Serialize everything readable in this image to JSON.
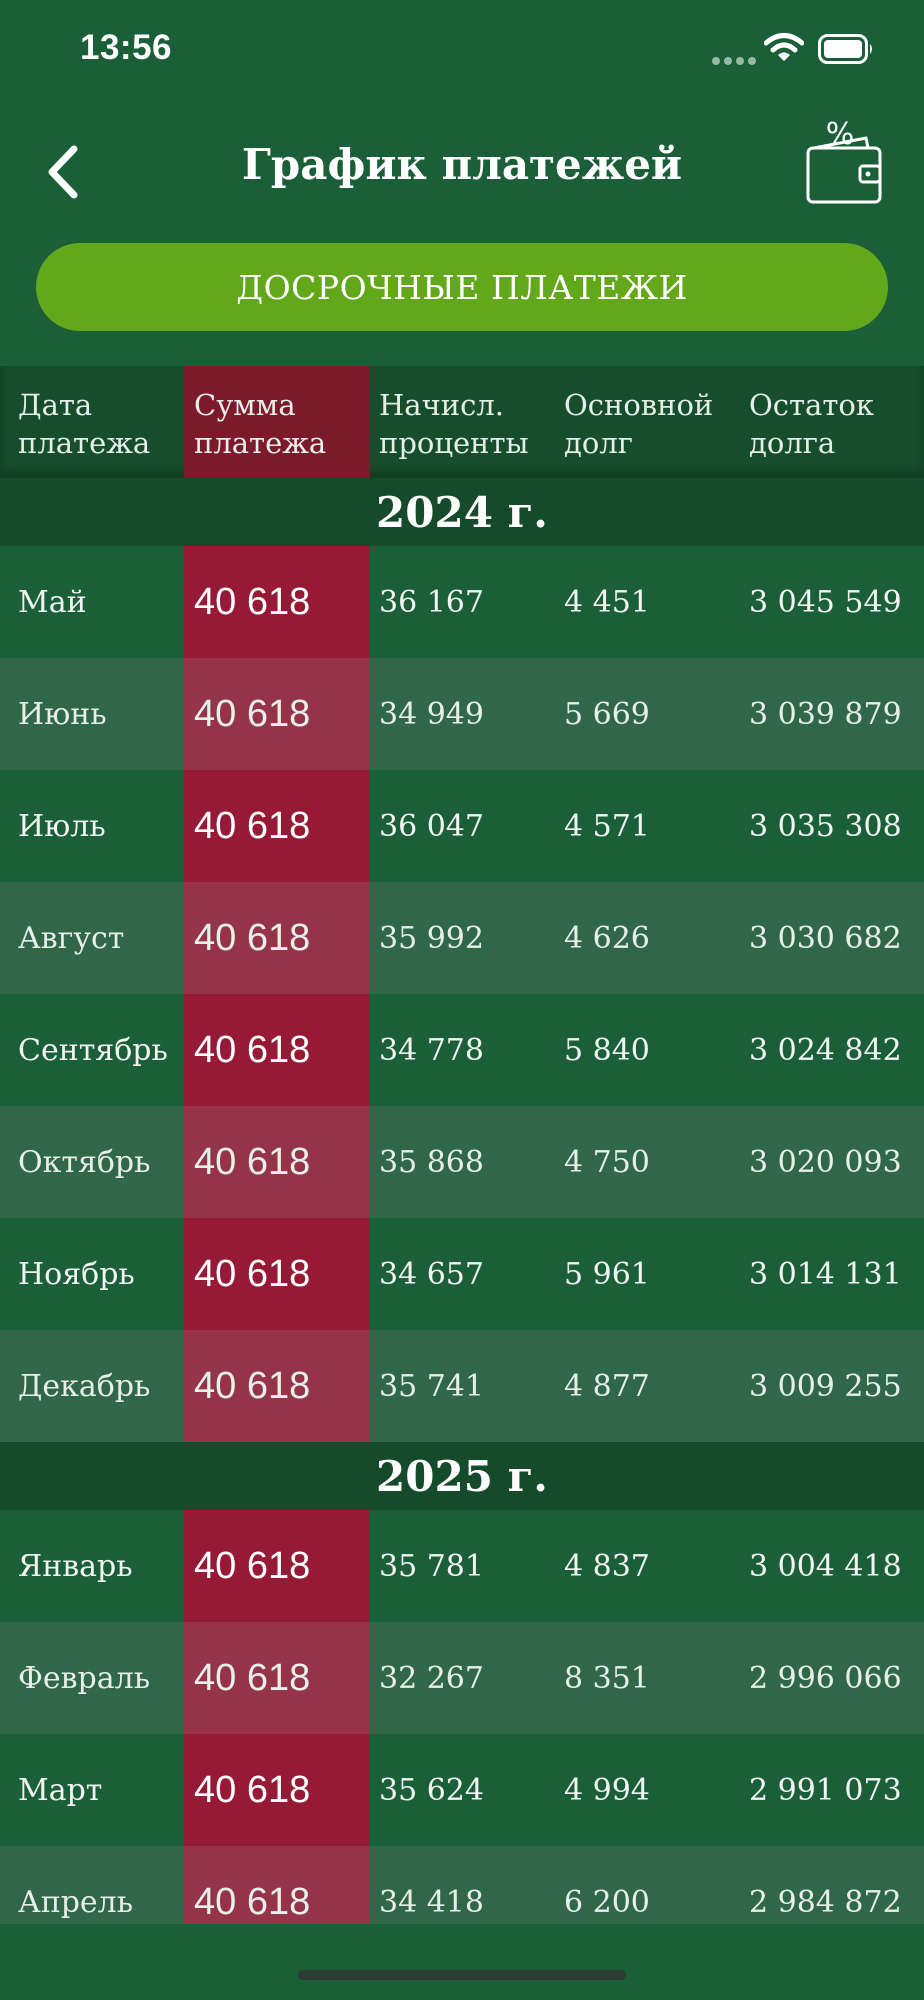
{
  "status_bar": {
    "time": "13:56"
  },
  "header": {
    "title": "График платежей",
    "back_icon": "chevron-left-icon",
    "wallet_icon": "wallet-percent-icon"
  },
  "early_payments_button": {
    "label": "ДОСРОЧНЫЕ ПЛАТЕЖИ",
    "color": "#63a81a"
  },
  "colors": {
    "background": "#1b5f38",
    "highlight_column": "#961a35"
  },
  "table": {
    "columns": [
      [
        "Дата",
        "платежа"
      ],
      [
        "Сумма",
        "платежа"
      ],
      [
        "Начисл.",
        "проценты"
      ],
      [
        "Основной",
        "долг"
      ],
      [
        "Остаток",
        "долга"
      ]
    ],
    "groups": [
      {
        "year": "2024 г.",
        "rows": [
          [
            "Май",
            "40 618",
            "36 167",
            "4 451",
            "3 045 549"
          ],
          [
            "Июнь",
            "40 618",
            "34 949",
            "5 669",
            "3 039 879"
          ],
          [
            "Июль",
            "40 618",
            "36 047",
            "4 571",
            "3 035 308"
          ],
          [
            "Август",
            "40 618",
            "35 992",
            "4 626",
            "3 030 682"
          ],
          [
            "Сентябрь",
            "40 618",
            "34 778",
            "5 840",
            "3 024 842"
          ],
          [
            "Октябрь",
            "40 618",
            "35 868",
            "4 750",
            "3 020 093"
          ],
          [
            "Ноябрь",
            "40 618",
            "34 657",
            "5 961",
            "3 014 131"
          ],
          [
            "Декабрь",
            "40 618",
            "35 741",
            "4 877",
            "3 009 255"
          ]
        ]
      },
      {
        "year": "2025 г.",
        "rows": [
          [
            "Январь",
            "40 618",
            "35 781",
            "4 837",
            "3 004 418"
          ],
          [
            "Февраль",
            "40 618",
            "32 267",
            "8 351",
            "2 996 066"
          ],
          [
            "Март",
            "40 618",
            "35 624",
            "4 994",
            "2 991 073"
          ],
          [
            "Апрель",
            "40 618",
            "34 418",
            "6 200",
            "2 984 872"
          ]
        ]
      }
    ]
  }
}
